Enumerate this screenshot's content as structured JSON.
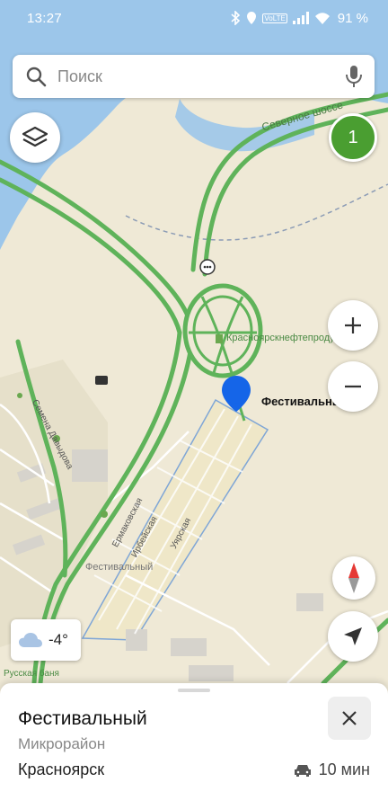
{
  "status_bar": {
    "time": "13:27",
    "network": "VoLTE",
    "battery": "91 %"
  },
  "search": {
    "placeholder": "Поиск",
    "search_icon": "search-icon",
    "mic_icon": "microphone-icon"
  },
  "controls": {
    "layers_icon": "layers-icon",
    "counter": "1",
    "zoom_in": "+",
    "zoom_out": "−",
    "compass_icon": "compass-icon",
    "locate_icon": "navigation-arrow-icon"
  },
  "weather": {
    "icon": "cloud-icon",
    "temp": "-4°"
  },
  "map": {
    "road_label_north": "Северное шоссе",
    "poi_oil": "Красноярскнефтепродукт",
    "selected_pin_label": "Фестивальный",
    "district_label": "Фестивальный",
    "street_1": "Ермаковская",
    "street_2": "Ирбейская",
    "street_3": "Уярская",
    "street_4": "Семена Давыдова",
    "bath_label": "Русская баня",
    "colors": {
      "land": "#efe9d6",
      "water": "#9cc6ea",
      "highway": "#5fb35a",
      "pin": "#1565e8"
    }
  },
  "place_card": {
    "name": "Фестивальный",
    "type": "Микрорайон",
    "city": "Красноярск",
    "drive_time": "10 мин",
    "close_icon": "close-icon",
    "car_icon": "car-icon"
  }
}
